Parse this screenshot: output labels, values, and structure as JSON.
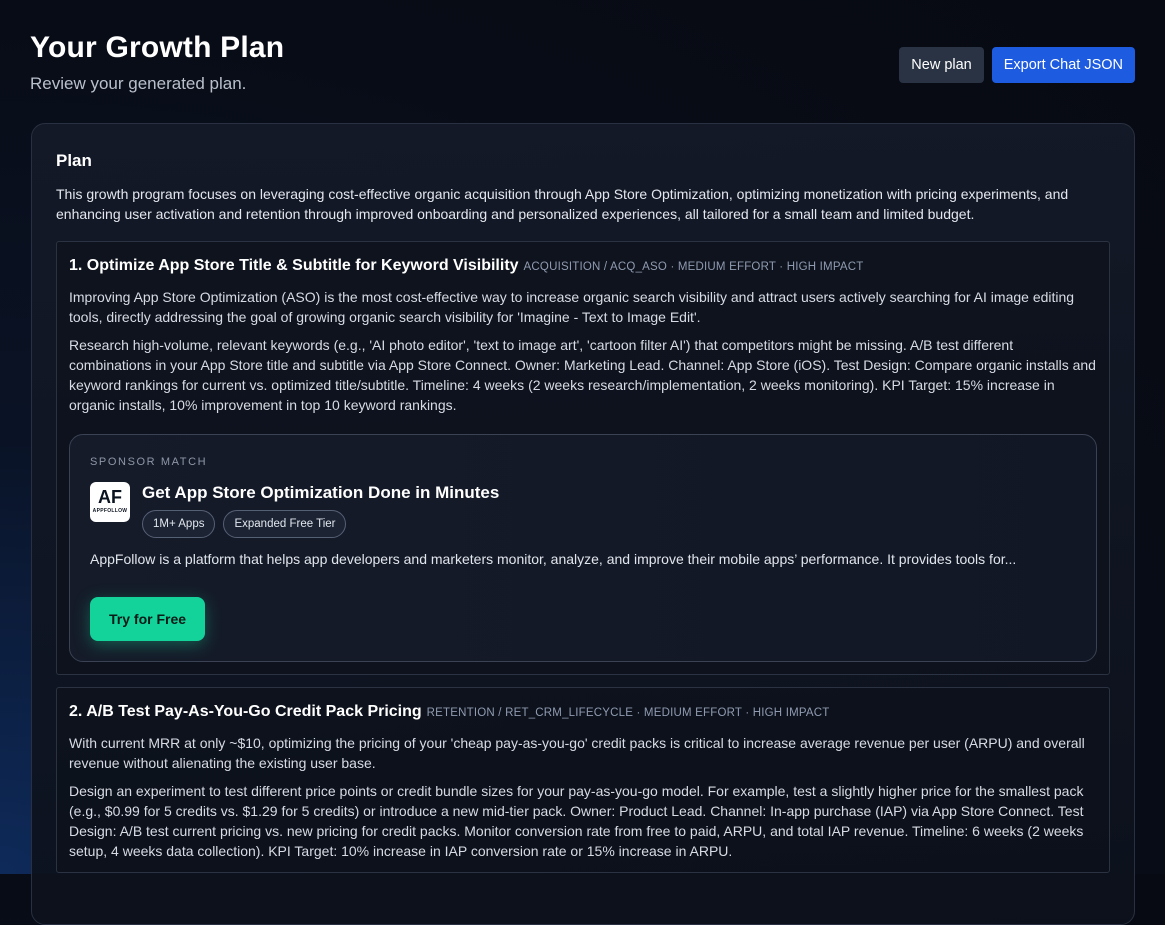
{
  "header": {
    "title": "Your Growth Plan",
    "subtitle": "Review your generated plan.",
    "new_plan_label": "New plan",
    "export_label": "Export Chat JSON"
  },
  "plan": {
    "heading": "Plan",
    "summary": "This growth program focuses on leveraging cost-effective organic acquisition through App Store Optimization, optimizing monetization with pricing experiments, and enhancing user activation and retention through improved onboarding and personalized experiences, all tailored for a small team and limited budget.",
    "items": [
      {
        "title": "1. Optimize App Store Title & Subtitle for Keyword Visibility",
        "meta": "ACQUISITION / ACQ_ASO · MEDIUM EFFORT · HIGH IMPACT",
        "rationale": "Improving App Store Optimization (ASO) is the most cost-effective way to increase organic search visibility and attract users actively searching for AI image editing tools, directly addressing the goal of growing organic search visibility for 'Imagine - Text to Image Edit'.",
        "details": "Research high-volume, relevant keywords (e.g., 'AI photo editor', 'text to image art', 'cartoon filter AI') that competitors might be missing. A/B test different combinations in your App Store title and subtitle via App Store Connect. Owner: Marketing Lead. Channel: App Store (iOS). Test Design: Compare organic installs and keyword rankings for current vs. optimized title/subtitle. Timeline: 4 weeks (2 weeks research/implementation, 2 weeks monitoring). KPI Target: 15% increase in organic installs, 10% improvement in top 10 keyword rankings."
      },
      {
        "title": "2. A/B Test Pay-As-You-Go Credit Pack Pricing",
        "meta": "RETENTION / RET_CRM_LIFECYCLE · MEDIUM EFFORT · HIGH IMPACT",
        "rationale": "With current MRR at only ~$10, optimizing the pricing of your 'cheap pay-as-you-go' credit packs is critical to increase average revenue per user (ARPU) and overall revenue without alienating the existing user base.",
        "details": "Design an experiment to test different price points or credit bundle sizes for your pay-as-you-go model. For example, test a slightly higher price for the smallest pack (e.g., $0.99 for 5 credits vs. $1.29 for 5 credits) or introduce a new mid-tier pack. Owner: Product Lead. Channel: In-app purchase (IAP) via App Store Connect. Test Design: A/B test current pricing vs. new pricing for credit packs. Monitor conversion rate from free to paid, ARPU, and total IAP revenue. Timeline: 6 weeks (2 weeks setup, 4 weeks data collection). KPI Target: 10% increase in IAP conversion rate or 15% increase in ARPU."
      }
    ]
  },
  "sponsor": {
    "kicker": "SPONSOR MATCH",
    "logo_mark": "AF",
    "logo_sub": "APPFOLLOW",
    "headline": "Get App Store Optimization Done in Minutes",
    "badges": [
      "1M+ Apps",
      "Expanded Free Tier"
    ],
    "description": "AppFollow is a platform that helps app developers and marketers monitor, analyze, and improve their mobile apps’ performance. It provides tools for...",
    "cta_label": "Try for Free",
    "cta_color": "#14d39a"
  }
}
